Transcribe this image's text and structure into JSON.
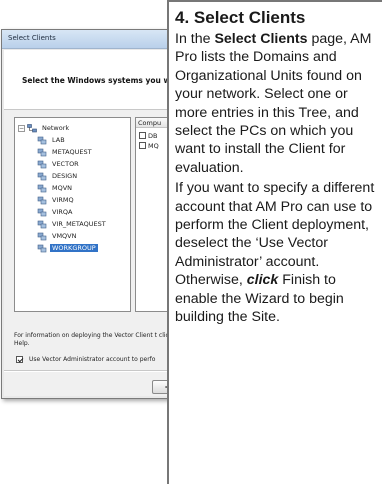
{
  "dialog": {
    "title": "Select Clients",
    "heading": "Select the Windows systems you wa",
    "tree": {
      "root": "Network",
      "root_expander": "−",
      "items": [
        "LAB",
        "METAQUEST",
        "VECTOR",
        "DESIGN",
        "MQVN",
        "VIRMQ",
        "VIRQA",
        "VIR_METAQUEST",
        "VMQVN",
        "WORKGROUP"
      ],
      "selected": "WORKGROUP"
    },
    "computers": {
      "column_header": "Compu",
      "rows": [
        "DB",
        "MQ"
      ]
    },
    "info_text": "For information on deploying the Vector Client t click Help.",
    "use_admin_label": "Use Vector Administrator account to perfo",
    "use_admin_checked": true,
    "back_button": "< Back"
  },
  "callout": {
    "title": "4. Select Clients",
    "p1_pre": "In the ",
    "p1_bold": "Select Clients",
    "p1_post": " page, AM Pro lists the Domains and Organizational Units found on your network. Select one or more entries in this Tree, and select the PCs on which you want to install the Client for evaluation.",
    "p2_pre": "If you want to specify a different account that AM Pro can use to perform the Client deployment, deselect the ‘Use Vector Administrator’ account. Otherwise, ",
    "p2_bold_italic": "click",
    "p2_post": " Finish to enable the Wizard to begin building the Site."
  }
}
